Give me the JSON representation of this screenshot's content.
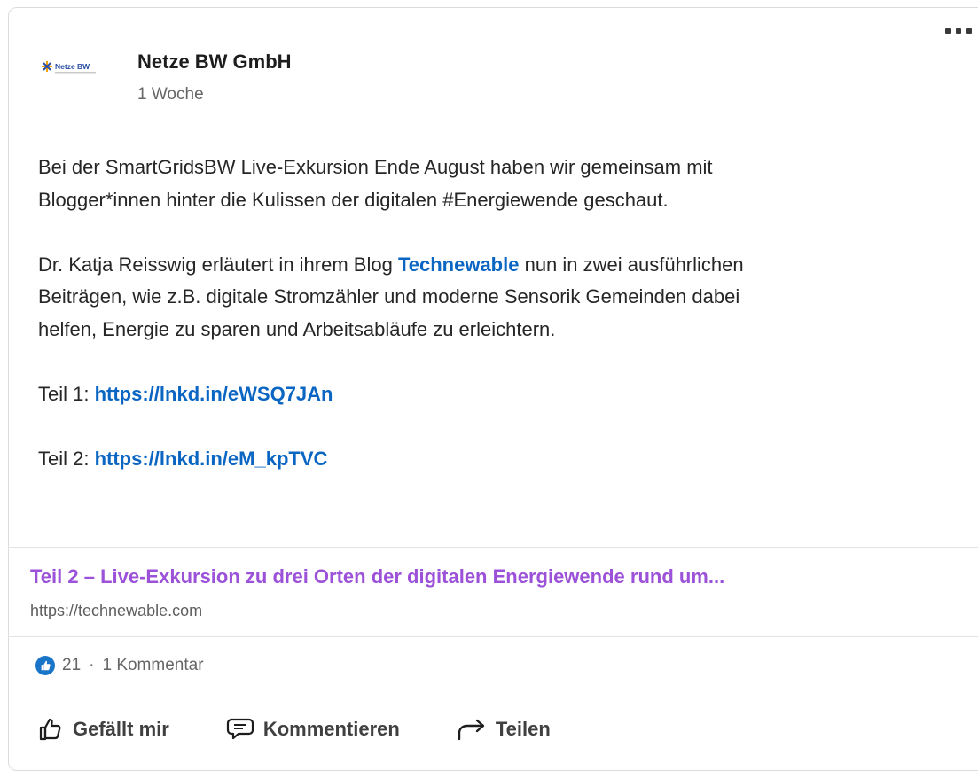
{
  "post": {
    "author": "Netze BW GmbH",
    "time_ago": "1 Woche",
    "logo_text": "Netze BW",
    "icons": {
      "more": "more-horizontal-icon",
      "logo": "netze-bw-logo",
      "like_badge": "thumbs-up-icon"
    },
    "body": {
      "p1_line1": "Bei der SmartGridsBW Live-Exkursion Ende August haben wir gemeinsam mit",
      "p1_line2_pre": "Blogger*innen hinter die Kulissen der digitalen ",
      "hashtag": "#Energiewende",
      "p1_line2_post": " geschaut.",
      "p2_pre": "Dr. Katja Reisswig erläutert in ihrem Blog ",
      "p2_link": "Technewable",
      "p2_post_line1": " nun in zwei ausführlichen",
      "p2_line2": "Beiträgen, wie z.B. digitale Stromzähler und moderne Sensorik Gemeinden dabei",
      "p2_line3": "helfen, Energie zu sparen und Arbeitsabläufe zu erleichtern.",
      "teil1_label": "Teil 1: ",
      "teil1_url": "https://lnkd.in/eWSQ7JAn",
      "teil2_label": "Teil 2: ",
      "teil2_url": "https://lnkd.in/eM_kpTVC"
    },
    "preview": {
      "title": "Teil 2 – Live-Exkursion zu drei Orten der digitalen Energiewende rund um...",
      "url": "https://technewable.com"
    },
    "social": {
      "reactions": "21",
      "separator": "·",
      "comments": "1 Kommentar"
    },
    "actions": {
      "like": "Gefällt mir",
      "comment": "Kommentieren",
      "share": "Teilen"
    },
    "colors": {
      "link": "#0a66c2",
      "preview_title": "#9b52d8",
      "like_badge": "#1a75c8"
    }
  }
}
